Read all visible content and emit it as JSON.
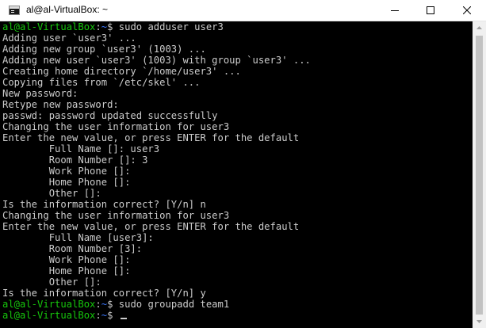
{
  "window": {
    "title": "al@al-VirtualBox: ~",
    "controls": {
      "minimize": "minimize",
      "maximize": "maximize",
      "close": "close"
    }
  },
  "terminal": {
    "prompt": {
      "user_host": "al@al-VirtualBox",
      "colon": ":",
      "path": "~",
      "symbol": "$ "
    },
    "lines": [
      {
        "type": "cmd",
        "command": "sudo adduser user3"
      },
      {
        "type": "out",
        "text": "Adding user `user3' ..."
      },
      {
        "type": "out",
        "text": "Adding new group `user3' (1003) ..."
      },
      {
        "type": "out",
        "text": "Adding new user `user3' (1003) with group `user3' ..."
      },
      {
        "type": "out",
        "text": "Creating home directory `/home/user3' ..."
      },
      {
        "type": "out",
        "text": "Copying files from `/etc/skel' ..."
      },
      {
        "type": "out",
        "text": "New password:"
      },
      {
        "type": "out",
        "text": "Retype new password:"
      },
      {
        "type": "out",
        "text": "passwd: password updated successfully"
      },
      {
        "type": "out",
        "text": "Changing the user information for user3"
      },
      {
        "type": "out",
        "text": "Enter the new value, or press ENTER for the default"
      },
      {
        "type": "out",
        "text": "        Full Name []: user3"
      },
      {
        "type": "out",
        "text": "        Room Number []: 3"
      },
      {
        "type": "out",
        "text": "        Work Phone []:"
      },
      {
        "type": "out",
        "text": "        Home Phone []:"
      },
      {
        "type": "out",
        "text": "        Other []:"
      },
      {
        "type": "out",
        "text": "Is the information correct? [Y/n] n"
      },
      {
        "type": "out",
        "text": "Changing the user information for user3"
      },
      {
        "type": "out",
        "text": "Enter the new value, or press ENTER for the default"
      },
      {
        "type": "out",
        "text": "        Full Name [user3]:"
      },
      {
        "type": "out",
        "text": "        Room Number [3]:"
      },
      {
        "type": "out",
        "text": "        Work Phone []:"
      },
      {
        "type": "out",
        "text": "        Home Phone []:"
      },
      {
        "type": "out",
        "text": "        Other []:"
      },
      {
        "type": "out",
        "text": "Is the information correct? [Y/n] y"
      },
      {
        "type": "cmd",
        "command": "sudo groupadd team1"
      },
      {
        "type": "cmd",
        "command": "",
        "cursor": true
      }
    ]
  },
  "colors": {
    "prompt_user": "#16c60c",
    "prompt_path": "#3b78ff",
    "text": "#cccccc",
    "background": "#000000"
  }
}
